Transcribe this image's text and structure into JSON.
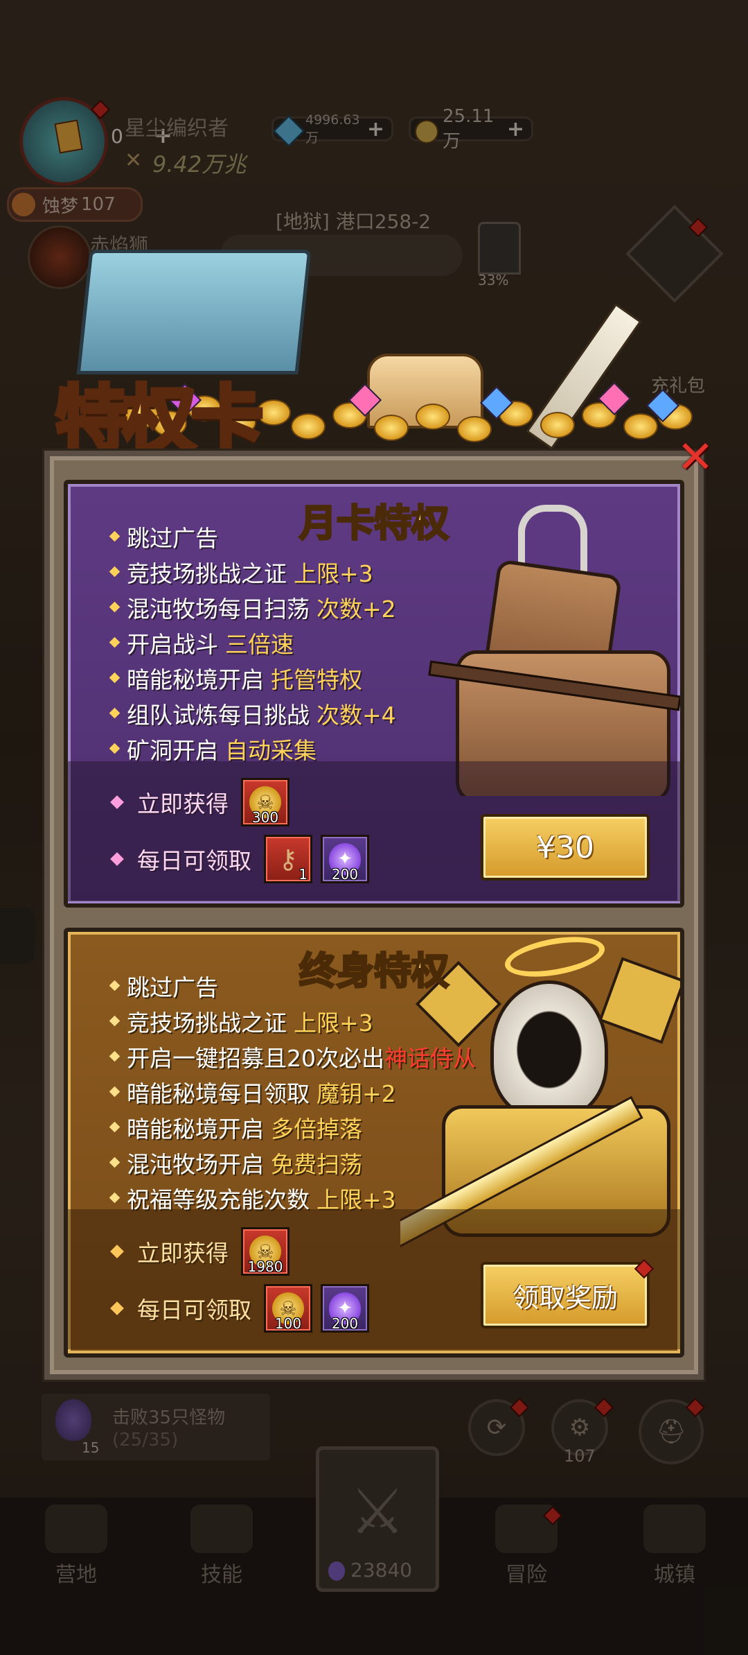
{
  "top": {
    "player_name": "星尘编织者",
    "power": "9.42万兆",
    "currency_small": "0",
    "gems": "4996.63万",
    "gold": "25.11万",
    "level_label": "蚀梦",
    "level_value": "107",
    "npc_name": "赤焰狮",
    "stage": "[地狱] 港口258-2",
    "stage_progress": "33%",
    "recharge_pack": "充礼包"
  },
  "title": "特权卡",
  "monthly_card": {
    "title": "月卡特权",
    "benefits": [
      {
        "text": "跳过广告",
        "highlight": ""
      },
      {
        "text": "竞技场挑战之证",
        "highlight": "上限+3"
      },
      {
        "text": "混沌牧场每日扫荡",
        "highlight": "次数+2"
      },
      {
        "text": "开启战斗",
        "highlight": "三倍速"
      },
      {
        "text": "暗能秘境开启",
        "highlight": "托管特权"
      },
      {
        "text": "组队试炼每日挑战",
        "highlight": "次数+4"
      },
      {
        "text": "矿洞开启",
        "highlight": "自动采集"
      }
    ],
    "instant_label": "立即获得",
    "instant_item_count": "300",
    "daily_label": "每日可领取",
    "daily_items": [
      {
        "icon": "key-icon",
        "count": "1"
      },
      {
        "icon": "flame-icon",
        "count": "200"
      }
    ],
    "price_button": "¥30"
  },
  "lifetime_card": {
    "title": "终身特权",
    "benefits": [
      {
        "text": "跳过广告",
        "highlight": ""
      },
      {
        "text": "竞技场挑战之证",
        "highlight": "上限+3"
      },
      {
        "text": "开启一键招募且20次必出",
        "highlight": "神话侍从"
      },
      {
        "text": "暗能秘境每日领取",
        "highlight": "魔钥+2"
      },
      {
        "text": "暗能秘境开启",
        "highlight": "多倍掉落"
      },
      {
        "text": "混沌牧场开启",
        "highlight": "免费扫荡"
      },
      {
        "text": "祝福等级充能次数",
        "highlight": "上限+3"
      }
    ],
    "instant_label": "立即获得",
    "instant_item_count": "1980",
    "daily_label": "每日可领取",
    "daily_items": [
      {
        "icon": "skull-coin-icon",
        "count": "100"
      },
      {
        "icon": "flame-icon",
        "count": "200"
      }
    ],
    "claim_button": "领取奖励"
  },
  "quest": {
    "text": "击败35只怪物",
    "progress": "(25/35)",
    "count": "15"
  },
  "round_buttons": {
    "settings_count": "107"
  },
  "bottom_nav": {
    "camp": "营地",
    "skills": "技能",
    "battle_count": "23840",
    "adventure": "冒险",
    "town": "城镇"
  }
}
